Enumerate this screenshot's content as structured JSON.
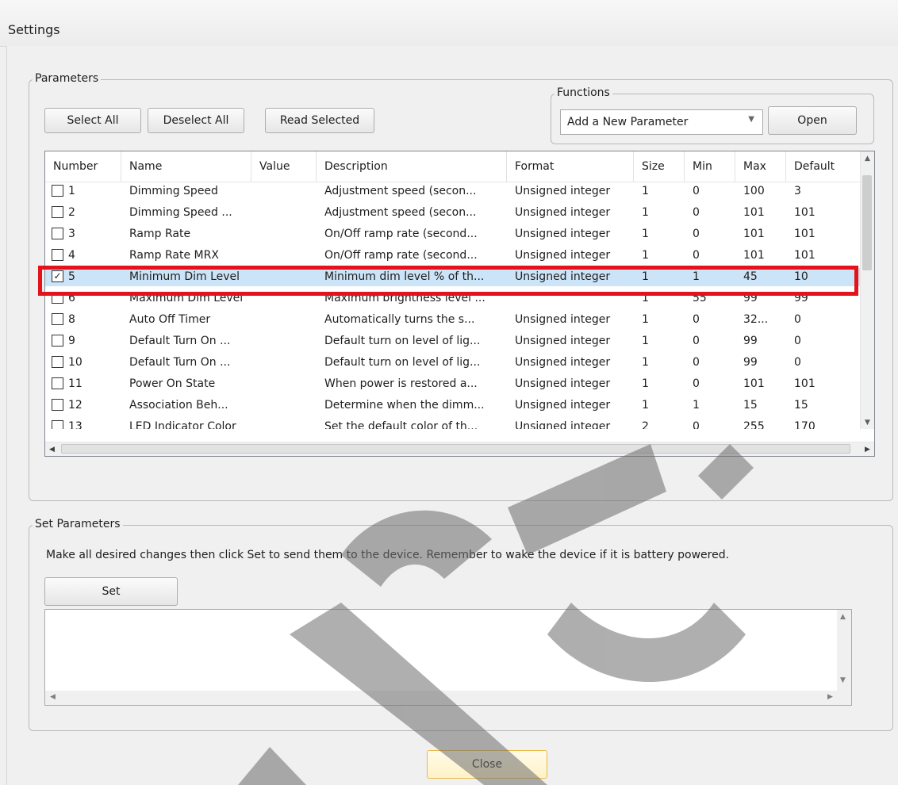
{
  "window": {
    "title": "Settings"
  },
  "parameters_group": {
    "label": "Parameters",
    "select_all": "Select All",
    "deselect_all": "Deselect All",
    "read_selected": "Read Selected"
  },
  "functions_group": {
    "label": "Functions",
    "dropdown_value": "Add a New Parameter",
    "open": "Open"
  },
  "table": {
    "columns": [
      "Number",
      "Name",
      "Value",
      "Description",
      "Format",
      "Size",
      "Min",
      "Max",
      "Default"
    ],
    "rows": [
      {
        "checked": false,
        "number": "1",
        "name": "Dimming Speed",
        "value": "",
        "description": "Adjustment speed (secon...",
        "format": "Unsigned integer",
        "size": "1",
        "min": "0",
        "max": "100",
        "default": "3"
      },
      {
        "checked": false,
        "number": "2",
        "name": "Dimming Speed ...",
        "value": "",
        "description": "Adjustment speed (secon...",
        "format": "Unsigned integer",
        "size": "1",
        "min": "0",
        "max": "101",
        "default": "101"
      },
      {
        "checked": false,
        "number": "3",
        "name": "Ramp Rate",
        "value": "",
        "description": "On/Off ramp rate (second...",
        "format": "Unsigned integer",
        "size": "1",
        "min": "0",
        "max": "101",
        "default": "101"
      },
      {
        "checked": false,
        "number": "4",
        "name": "Ramp Rate MRX",
        "value": "",
        "description": "On/Off ramp rate (second...",
        "format": "Unsigned integer",
        "size": "1",
        "min": "0",
        "max": "101",
        "default": "101"
      },
      {
        "checked": true,
        "number": "5",
        "name": "Minimum Dim Level",
        "value": "",
        "description": "Minimum dim level % of th...",
        "format": "Unsigned integer",
        "size": "1",
        "min": "1",
        "max": "45",
        "default": "10"
      },
      {
        "checked": false,
        "number": "6",
        "name": "Maximum Dim Level",
        "value": "",
        "description": "Maximum brightness level ...",
        "format": "",
        "size": "1",
        "min": "55",
        "max": "99",
        "default": "99"
      },
      {
        "checked": false,
        "number": "8",
        "name": "Auto Off Timer",
        "value": "",
        "description": "Automatically turns the s...",
        "format": "Unsigned integer",
        "size": "1",
        "min": "0",
        "max": "32...",
        "default": "0"
      },
      {
        "checked": false,
        "number": "9",
        "name": "Default Turn On ...",
        "value": "",
        "description": "Default turn on level of lig...",
        "format": "Unsigned integer",
        "size": "1",
        "min": "0",
        "max": "99",
        "default": "0"
      },
      {
        "checked": false,
        "number": "10",
        "name": "Default Turn On ...",
        "value": "",
        "description": "Default turn on level of lig...",
        "format": "Unsigned integer",
        "size": "1",
        "min": "0",
        "max": "99",
        "default": "0"
      },
      {
        "checked": false,
        "number": "11",
        "name": "Power On State",
        "value": "",
        "description": "When power is restored a...",
        "format": "Unsigned integer",
        "size": "1",
        "min": "0",
        "max": "101",
        "default": "101"
      },
      {
        "checked": false,
        "number": "12",
        "name": "Association Beh...",
        "value": "",
        "description": "Determine when the dimm...",
        "format": "Unsigned integer",
        "size": "1",
        "min": "1",
        "max": "15",
        "default": "15"
      },
      {
        "checked": false,
        "number": "13",
        "name": "LED Indicator Color",
        "value": "",
        "description": "Set the default color of th...",
        "format": "Unsigned integer",
        "size": "2",
        "min": "0",
        "max": "255",
        "default": "170"
      }
    ]
  },
  "set_group": {
    "label": "Set Parameters",
    "hint": "Make all desired changes then click Set to send them to the device. Remember to wake the device if it is battery powered.",
    "set": "Set",
    "log_text": ""
  },
  "footer": {
    "close": "Close"
  },
  "colors": {
    "selected_row": "#cce4f7",
    "highlight_box": "#e3121b",
    "close_border": "#e9b949"
  }
}
